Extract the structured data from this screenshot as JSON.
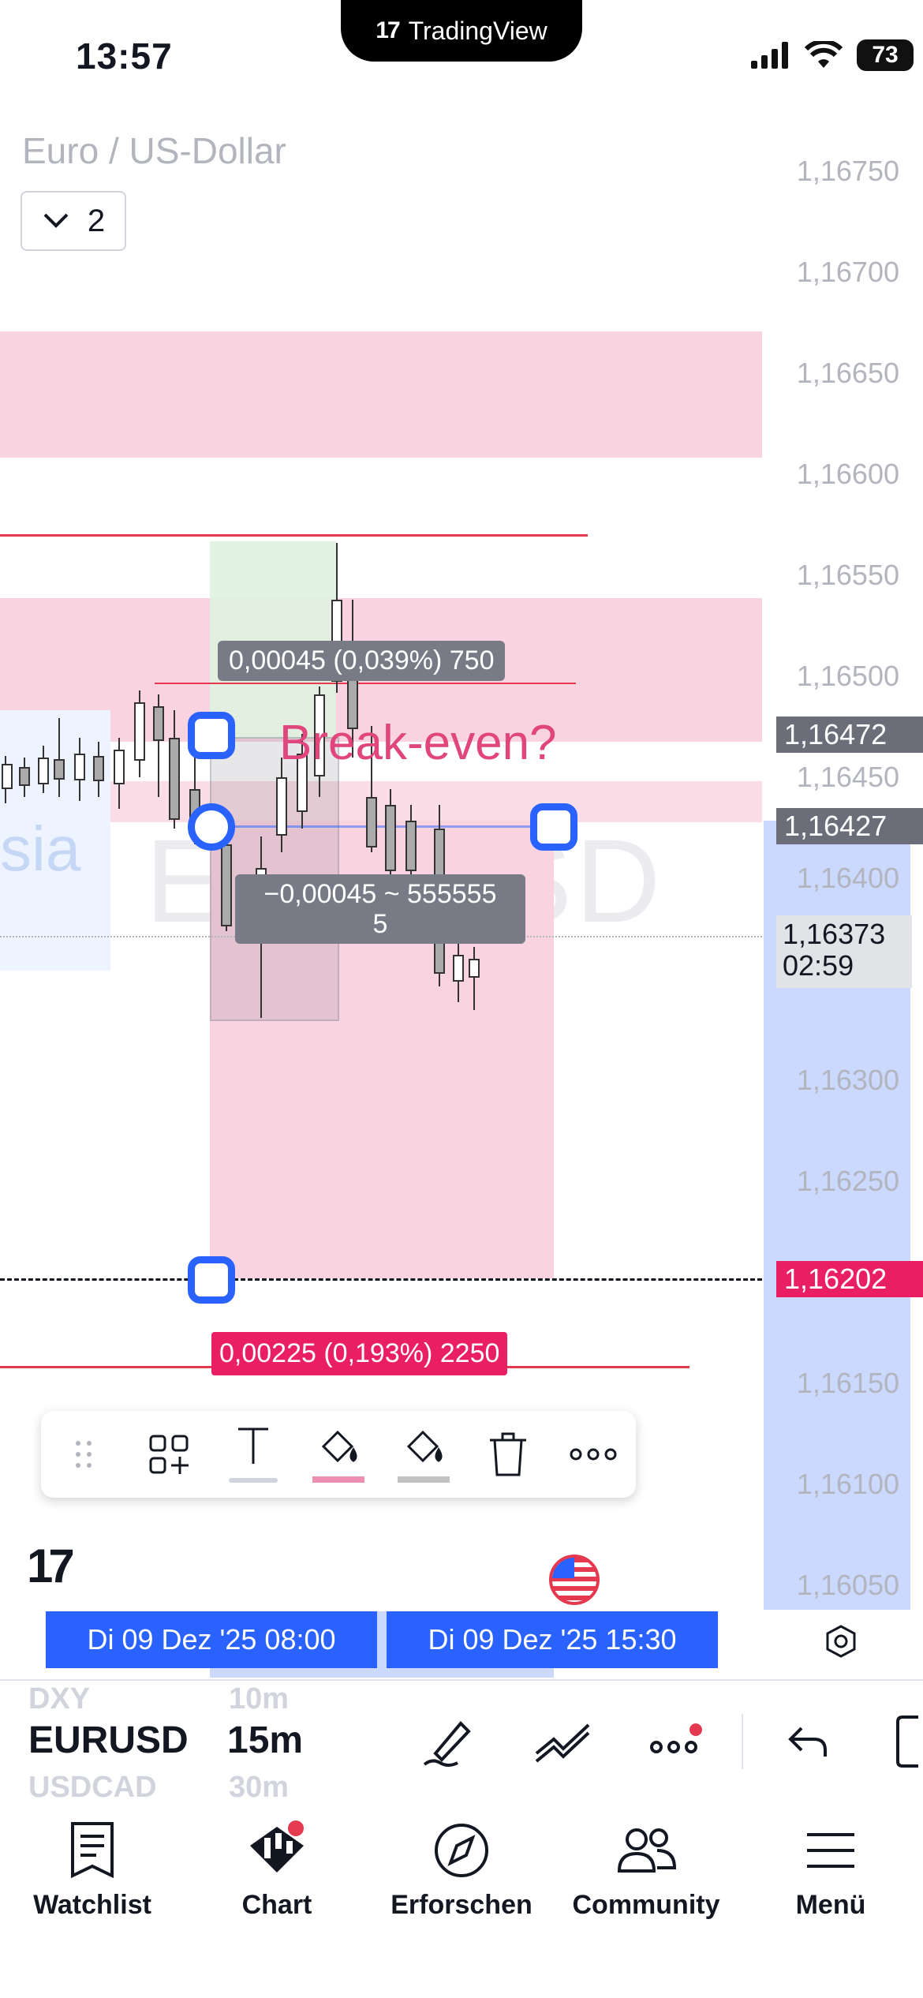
{
  "status_bar": {
    "time": "13:57",
    "app_name": "TradingView",
    "battery": "73"
  },
  "chart": {
    "pair_title": "Euro / US-Dollar",
    "layer_count": "2",
    "watermark": "EURUSD",
    "session_label": "sia",
    "price_axis": [
      "1,16750",
      "1,16700",
      "1,16650",
      "1,16600",
      "1,16550",
      "1,16500",
      "1,16450",
      "1,16400",
      "1,16300",
      "1,16250",
      "1,16150",
      "1,16100",
      "1,16050"
    ],
    "price_tags": {
      "upper_line": "1,16472",
      "entry": "1,16427",
      "current_price": "1,16373",
      "countdown": "02:59",
      "stop_line": "1,16202"
    },
    "annotation_text": "Break-even?",
    "ruler_top": "0,00045 (0,039%) 750",
    "ruler_bottom_line1": "−0,00045 ~ 555555",
    "ruler_bottom_line2": "5",
    "target_label": "0,00225 (0,193%) 2250",
    "colors": {
      "accent": "#2962ff",
      "zone": "#f9d4e0",
      "red": "#e91e63",
      "tag": "#787b86"
    }
  },
  "drawing_toolbar": {
    "items": [
      "drag-handle-icon",
      "add-object-icon",
      "text-icon",
      "line-color-icon",
      "fill-color-icon",
      "trash-icon",
      "more-icon"
    ]
  },
  "time_axis": {
    "start": "Di 09 Dez '25   08:00",
    "end": "Di 09 Dez '25   15:30"
  },
  "symbol_bar": {
    "symbol_prev": "DXY",
    "symbol": "EURUSD",
    "symbol_next": "USDCAD",
    "interval_prev": "10m",
    "interval": "15m",
    "interval_next": "30m"
  },
  "bottom_nav": [
    {
      "label": "Watchlist",
      "icon": "watchlist-icon"
    },
    {
      "label": "Chart",
      "icon": "chart-icon"
    },
    {
      "label": "Erforschen",
      "icon": "compass-icon"
    },
    {
      "label": "Community",
      "icon": "community-icon"
    },
    {
      "label": "Menü",
      "icon": "menu-icon"
    }
  ]
}
